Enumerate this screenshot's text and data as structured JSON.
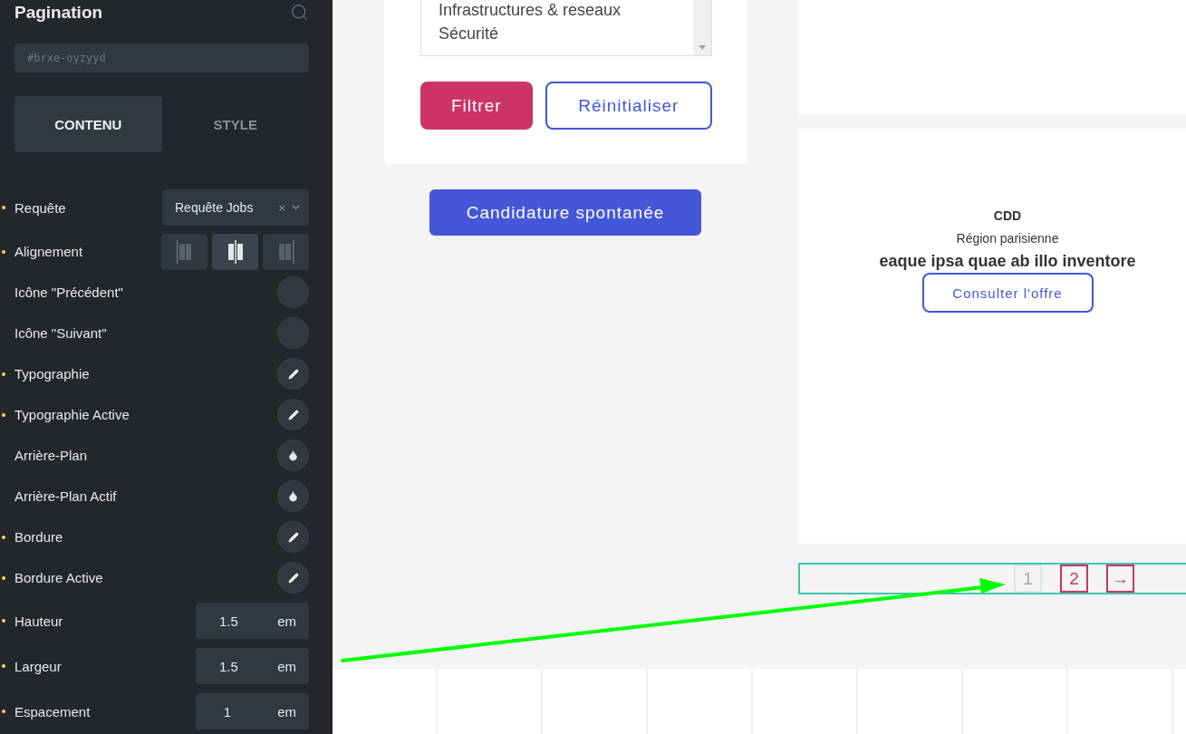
{
  "sidebar": {
    "title": "Pagination",
    "id_field": {
      "placeholder": "#brxe-oyzyyd"
    },
    "tabs": [
      {
        "label": "CONTENU",
        "selected": true
      },
      {
        "label": "STYLE",
        "selected": false
      }
    ],
    "controls": [
      {
        "label": "Requête",
        "modified": true,
        "kind": "select",
        "value": "Requête Jobs",
        "clear": "×"
      },
      {
        "label": "Alignement",
        "modified": true,
        "kind": "align",
        "options": [
          {
            "selected": false
          },
          {
            "selected": true
          },
          {
            "selected": false
          }
        ]
      },
      {
        "label": "Icône \"Précédent\"",
        "modified": false,
        "kind": "empty"
      },
      {
        "label": "Icône \"Suivant\"",
        "modified": false,
        "kind": "empty"
      },
      {
        "label": "Typographie",
        "modified": true,
        "kind": "edit"
      },
      {
        "label": "Typographie Active",
        "modified": true,
        "kind": "edit"
      },
      {
        "label": "Arrière-Plan",
        "modified": false,
        "kind": "color"
      },
      {
        "label": "Arrière-Plan Actif",
        "modified": false,
        "kind": "color"
      },
      {
        "label": "Bordure",
        "modified": true,
        "kind": "edit"
      },
      {
        "label": "Bordure Active",
        "modified": true,
        "kind": "edit"
      },
      {
        "label": "Hauteur",
        "modified": true,
        "kind": "number",
        "value": "1.5",
        "unit": "em"
      },
      {
        "label": "Largeur",
        "modified": true,
        "kind": "number",
        "value": "1.5",
        "unit": "em"
      },
      {
        "label": "Espacement",
        "modified": true,
        "kind": "number",
        "value": "1",
        "unit": "em"
      }
    ]
  },
  "filter": {
    "options": [
      "Infrastructures & reseaux",
      "Sécurité"
    ],
    "buttons": [
      {
        "label": "Filtrer",
        "kind": "primary"
      },
      {
        "label": "Réinitialiser",
        "kind": "outline"
      }
    ]
  },
  "spontaneous_button": "Candidature spontanée",
  "job_card": {
    "type": "CDD",
    "location": "Région parisienne",
    "title": "eaque ipsa quae ab illo inventore",
    "button": "Consulter l'offre"
  },
  "pagination": [
    {
      "label": "1",
      "selected": true
    },
    {
      "label": "2",
      "selected": false
    },
    {
      "label": "→",
      "selected": false
    }
  ]
}
